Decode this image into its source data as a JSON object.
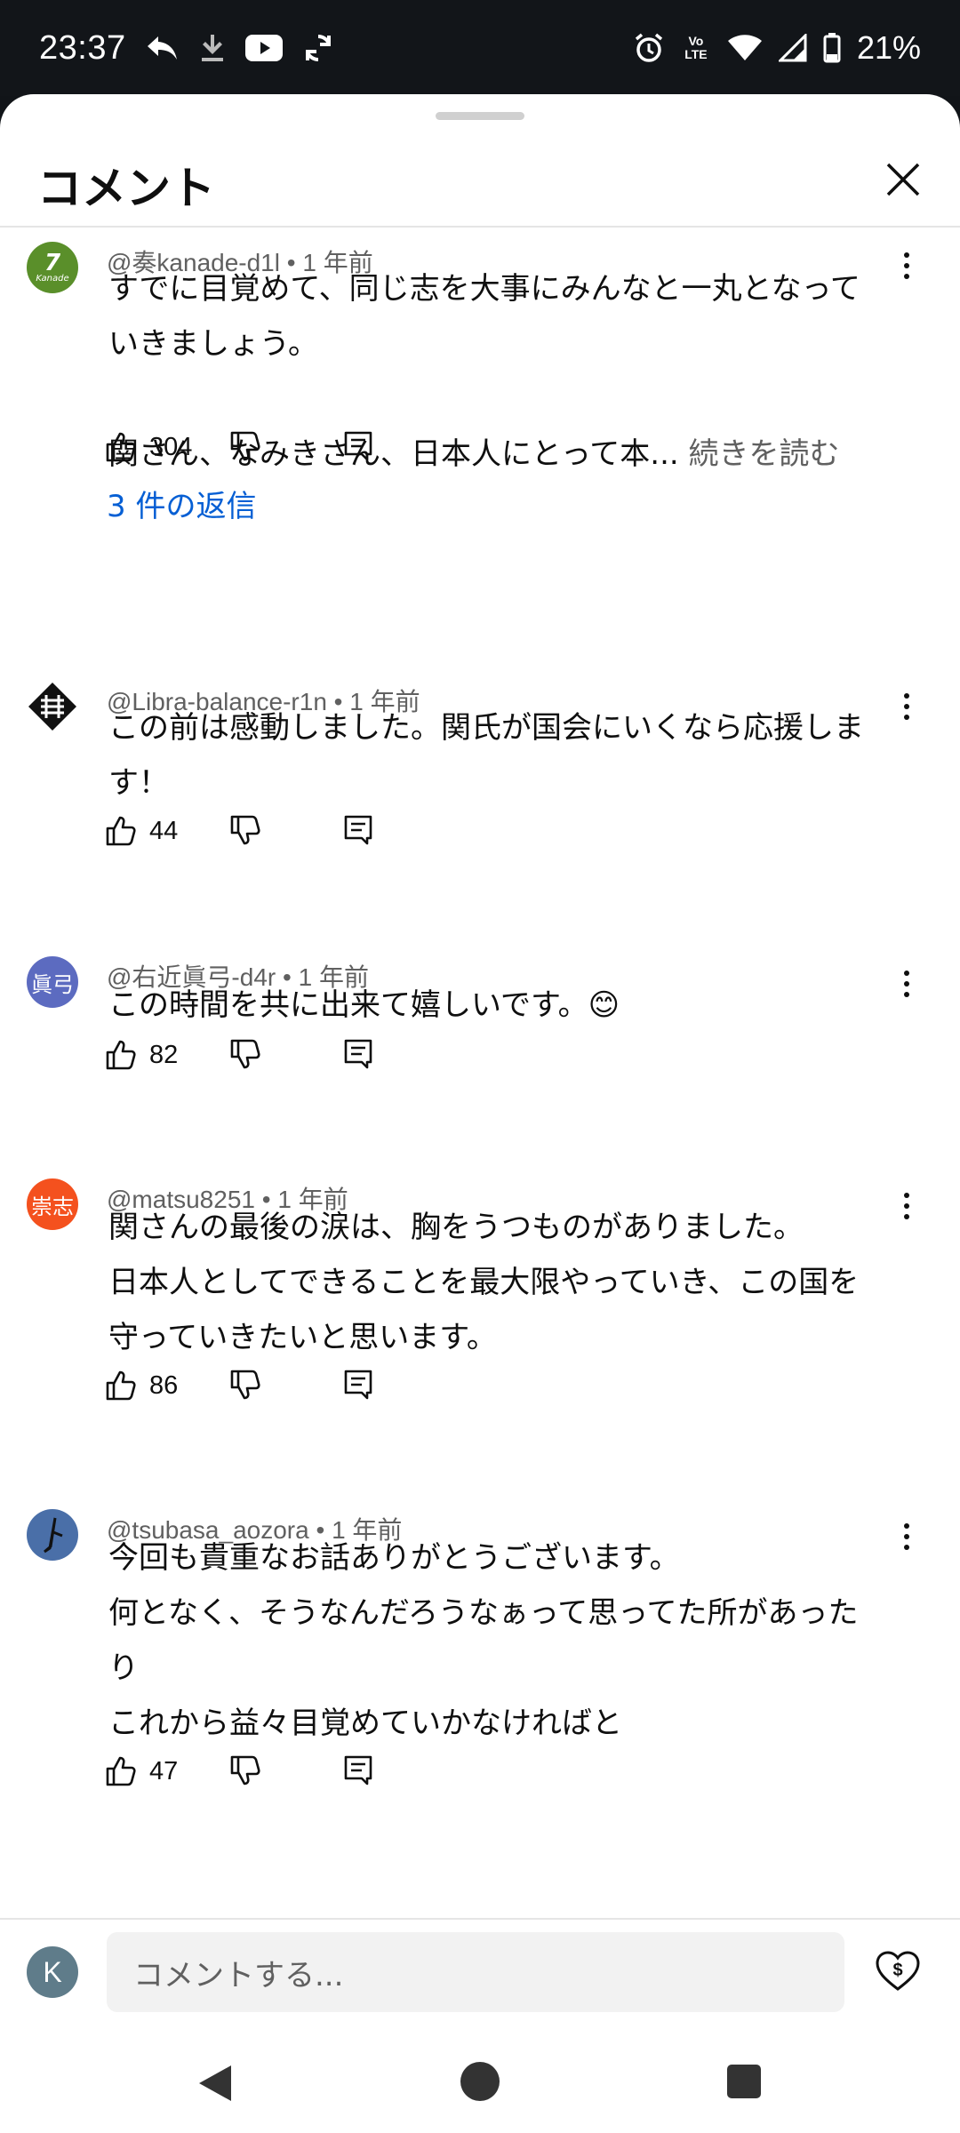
{
  "status_bar": {
    "time": "23:37",
    "battery": "21%",
    "left_icons": [
      "reply-arrow-icon",
      "download-icon",
      "youtube-icon",
      "sync-icon"
    ],
    "right_icons": [
      "alarm-icon",
      "volte-icon",
      "wifi-icon",
      "signal-icon",
      "battery-icon"
    ],
    "volte_label": "Vo LTE"
  },
  "sheet": {
    "title": "コメント",
    "close_icon": "close-icon"
  },
  "comments": [
    {
      "author": "@奏kanade-d1l",
      "time": "1 年前",
      "avatar_text": "7",
      "avatar_sub": "Kanade",
      "avatar_color": "#5a8f2a",
      "text": "すでに目覚めて、同じ志を大事にみんなと一丸となって\nいきましょう。\n\n関さん、なみきさん、日本人にとって本...",
      "more": "続きを読む",
      "likes": "304",
      "replies": "3 件の返信"
    },
    {
      "author": "@Libra-balance-r1n",
      "time": "1 年前",
      "avatar_text": "",
      "avatar_color": "#ffffff",
      "text": "この前は感動しました。関氏が国会にいくなら応援しま\nす！",
      "likes": "44"
    },
    {
      "author": "@右近眞弓-d4r",
      "time": "1 年前",
      "avatar_text": "眞弓",
      "avatar_color": "#5c6bc0",
      "text": "この時間を共に出来て嬉しいです。😊",
      "likes": "82"
    },
    {
      "author": "@matsu8251",
      "time": "1 年前",
      "avatar_text": "崇志",
      "avatar_color": "#f4511e",
      "text": "関さんの最後の涙は、胸をうつものがありました。\n日本人としてできることを最大限やっていき、この国を\n守っていきたいと思います。",
      "likes": "86"
    },
    {
      "author": "@tsubasa_aozora",
      "time": "1 年前",
      "avatar_text": "",
      "avatar_color": "#4a6fa8",
      "text": "今回も貴重なお話ありがとうございます。\n何となく、そうなんだろうなぁって思ってた所があった\nり\nこれから益々目覚めていかなければと",
      "likes": "47"
    }
  ],
  "input": {
    "my_avatar": "K",
    "placeholder": "コメントする..."
  },
  "colors": {
    "link": "#065fd4",
    "secondary_text": "#606060",
    "primary_text": "#0f0f0f"
  }
}
